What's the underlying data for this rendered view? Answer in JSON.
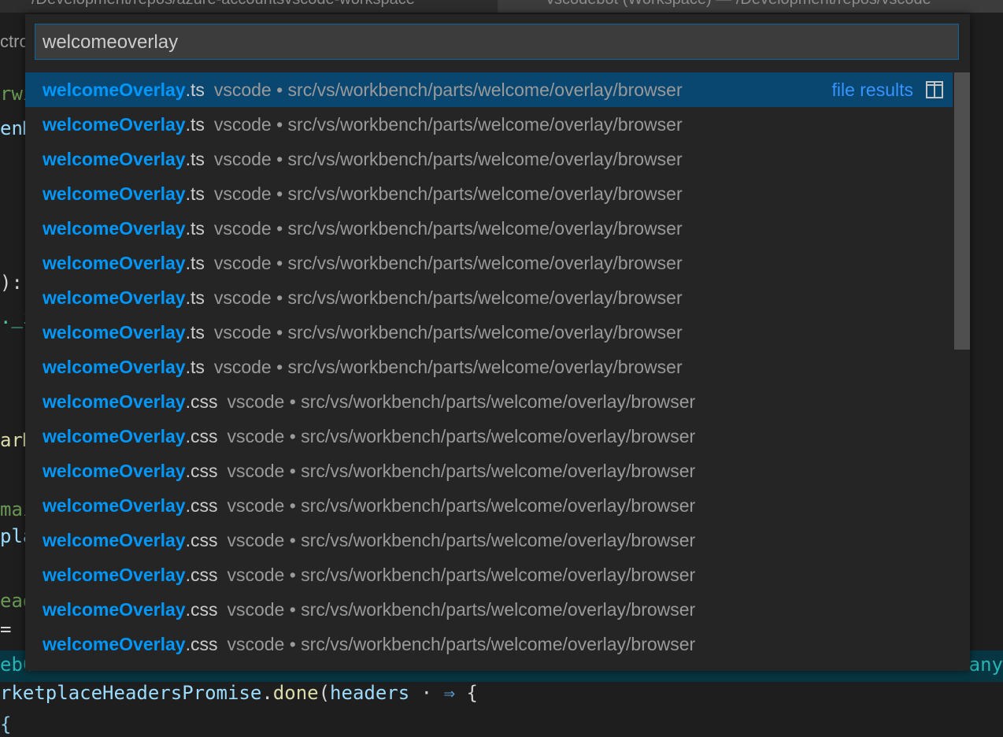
{
  "tabs": [
    {
      "label": "/Development/repos/azure-accountsvscode-workspace"
    },
    {
      "label": "vscodebot (Workspace)  —  /Development/repos/vscode"
    }
  ],
  "editor": {
    "crumb": "ctro",
    "fragments": [
      "rwi",
      "enM",
      "):",
      "._i",
      "arM",
      "mai",
      "pla",
      "ead",
      "= "
    ],
    "highlight_left": "ebC",
    "highlight_right": "any",
    "line1": {
      "obj": "rketplaceHeadersPromise",
      "dot": ".",
      "fn": "done",
      "open": "(",
      "param": "headers",
      "arrow": "⇒",
      "brace": "{"
    },
    "line2": "  {                                                    "
  },
  "quickopen": {
    "input_value": "welcomeoverlay",
    "group_label": "file results",
    "items": [
      {
        "match": "welcomeOverlay",
        "ext": ".ts",
        "desc": "vscode • src/vs/workbench/parts/welcome/overlay/browser"
      },
      {
        "match": "welcomeOverlay",
        "ext": ".ts",
        "desc": "vscode • src/vs/workbench/parts/welcome/overlay/browser"
      },
      {
        "match": "welcomeOverlay",
        "ext": ".ts",
        "desc": "vscode • src/vs/workbench/parts/welcome/overlay/browser"
      },
      {
        "match": "welcomeOverlay",
        "ext": ".ts",
        "desc": "vscode • src/vs/workbench/parts/welcome/overlay/browser"
      },
      {
        "match": "welcomeOverlay",
        "ext": ".ts",
        "desc": "vscode • src/vs/workbench/parts/welcome/overlay/browser"
      },
      {
        "match": "welcomeOverlay",
        "ext": ".ts",
        "desc": "vscode • src/vs/workbench/parts/welcome/overlay/browser"
      },
      {
        "match": "welcomeOverlay",
        "ext": ".ts",
        "desc": "vscode • src/vs/workbench/parts/welcome/overlay/browser"
      },
      {
        "match": "welcomeOverlay",
        "ext": ".ts",
        "desc": "vscode • src/vs/workbench/parts/welcome/overlay/browser"
      },
      {
        "match": "welcomeOverlay",
        "ext": ".ts",
        "desc": "vscode • src/vs/workbench/parts/welcome/overlay/browser"
      },
      {
        "match": "welcomeOverlay",
        "ext": ".css",
        "desc": "vscode • src/vs/workbench/parts/welcome/overlay/browser"
      },
      {
        "match": "welcomeOverlay",
        "ext": ".css",
        "desc": "vscode • src/vs/workbench/parts/welcome/overlay/browser"
      },
      {
        "match": "welcomeOverlay",
        "ext": ".css",
        "desc": "vscode • src/vs/workbench/parts/welcome/overlay/browser"
      },
      {
        "match": "welcomeOverlay",
        "ext": ".css",
        "desc": "vscode • src/vs/workbench/parts/welcome/overlay/browser"
      },
      {
        "match": "welcomeOverlay",
        "ext": ".css",
        "desc": "vscode • src/vs/workbench/parts/welcome/overlay/browser"
      },
      {
        "match": "welcomeOverlay",
        "ext": ".css",
        "desc": "vscode • src/vs/workbench/parts/welcome/overlay/browser"
      },
      {
        "match": "welcomeOverlay",
        "ext": ".css",
        "desc": "vscode • src/vs/workbench/parts/welcome/overlay/browser"
      },
      {
        "match": "welcomeOverlay",
        "ext": ".css",
        "desc": "vscode • src/vs/workbench/parts/welcome/overlay/browser"
      }
    ],
    "selected_index": 0,
    "icons": {
      "open_to_side": "split-editor-icon"
    },
    "colors": {
      "accent": "#0097fb",
      "selection": "#094771",
      "group": "#3794ff"
    }
  }
}
